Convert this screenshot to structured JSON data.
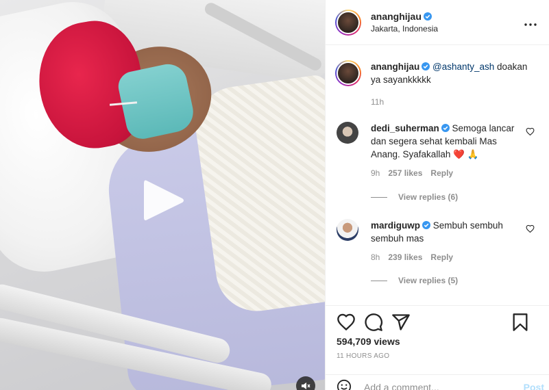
{
  "header": {
    "username": "ananghijau",
    "location": "Jakarta, Indonesia"
  },
  "caption": {
    "username": "ananghijau",
    "mention": "@ashanty_ash",
    "text": " doakan ya sayankkkkk",
    "time": "11h"
  },
  "comments": [
    {
      "username": "dedi_suherman",
      "text": "Semoga lancar dan segera sehat kembali Mas Anang. Syafakallah",
      "emoji": "❤️ 🙏",
      "time": "9h",
      "likes": "257 likes",
      "reply": "Reply",
      "view_replies": "View replies (6)"
    },
    {
      "username": "mardiguwp",
      "text": "Sembuh sembuh sembuh mas",
      "time": "8h",
      "likes": "239 likes",
      "reply": "Reply",
      "view_replies": "View replies (5)"
    }
  ],
  "stats": {
    "views": "594,709 views",
    "time_ago": "11 HOURS AGO"
  },
  "add_comment": {
    "placeholder": "Add a comment...",
    "post_label": "Post"
  },
  "icons": {
    "like": "heart-icon",
    "comment": "comment-icon",
    "share": "share-icon",
    "save": "bookmark-icon",
    "play": "play-icon",
    "mute": "mute-icon",
    "emoji": "emoji-icon",
    "verified": "verified-badge-icon",
    "more": "more-options-icon"
  },
  "colors": {
    "verified": "#3897f0",
    "muted": "#8e8e8e",
    "post_button": "#b2dffc"
  }
}
